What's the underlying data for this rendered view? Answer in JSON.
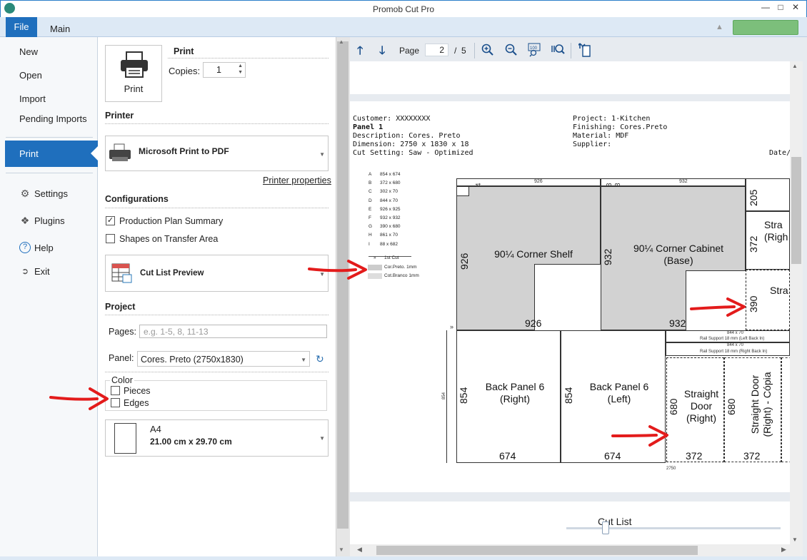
{
  "window": {
    "title": "Promob Cut Pro"
  },
  "tabs": {
    "file": "File",
    "main": "Main"
  },
  "menu": {
    "new": "New",
    "open": "Open",
    "import": "Import",
    "pending": "Pending Imports",
    "print": "Print",
    "settings": "Settings",
    "plugins": "Plugins",
    "help": "Help",
    "exit": "Exit"
  },
  "print_section": {
    "print_button": "Print",
    "title": "Print",
    "copies_label": "Copies:",
    "copies_value": "1"
  },
  "printer": {
    "title": "Printer",
    "name": "Microsoft Print to PDF",
    "properties_link": "Printer properties"
  },
  "configurations": {
    "title": "Configurations",
    "production_plan": "Production Plan Summary",
    "production_plan_checked": true,
    "shapes_transfer": "Shapes on Transfer Area",
    "shapes_transfer_checked": false,
    "report": "Cut List Preview"
  },
  "project": {
    "title": "Project",
    "pages_label": "Pages:",
    "pages_placeholder": "e.g. 1-5, 8, 11-13",
    "panel_label": "Panel:",
    "panel_value": "Cores. Preto (2750x1830)",
    "color_title": "Color",
    "pieces": "Pieces",
    "edges": "Edges",
    "paper_name": "A4",
    "paper_size": "21.00 cm x 29.70 cm"
  },
  "preview": {
    "page_label": "Page",
    "page_current": "2",
    "page_sep": "/",
    "page_total": "5",
    "header_left": [
      "Customer: XXXXXXXX",
      "Panel 1",
      "Description: Cores. Preto",
      "Dimension: 2750 x 1830 x 18",
      "Cut Setting: Saw - Optimized"
    ],
    "header_right": [
      "Project: 1-Kitchen",
      "Finishing: Cores.Preto",
      "Material: MDF",
      "Supplier:"
    ],
    "date_label": "Date/",
    "legend": [
      {
        "k": "A",
        "v": "854 x 674"
      },
      {
        "k": "B",
        "v": "372 x 680"
      },
      {
        "k": "C",
        "v": "302 x 70"
      },
      {
        "k": "D",
        "v": "844 x 70"
      },
      {
        "k": "E",
        "v": "926 x 925"
      },
      {
        "k": "F",
        "v": "932 x 932"
      },
      {
        "k": "G",
        "v": "390 x 680"
      },
      {
        "k": "H",
        "v": "861 x 70"
      },
      {
        "k": "I",
        "v": "88 x 682"
      }
    ],
    "legend_cut": "1st Cut",
    "legend_edge1": "Cor.Preto.  1mm",
    "legend_edge2": "Cot.Branco  1mm",
    "footer_label": "Cut List",
    "parts": {
      "p1_name": "90¼ Corner Shelf",
      "p1_w": "926",
      "p1_h": "926",
      "p1_top": "926",
      "p2_name": "90¼ Corner Cabinet (Base)",
      "p2_w": "932",
      "p2_h": "932",
      "p2_top": "932",
      "p3_name": "Back Panel 6 (Right)",
      "p3_w": "674",
      "p3_h": "854",
      "p4_name": "Back Panel 6 (Left)",
      "p4_w": "674",
      "p4_h": "854",
      "p5_name": "Straight Door (Right)",
      "p5_w": "372",
      "p5_h": "680",
      "p6_name": "Straight Door (Right) - Cópia",
      "p6_w": "372",
      "p6_h": "680",
      "p7_name": "Stra (Righ",
      "p7_h": "372",
      "p8_name": "Stra",
      "p8_h": "390",
      "top_right_dim": "205",
      "strip1": "Rail Support 18 mm (Left Back In)",
      "strip2": "Rail Support 18 mm (Right Back In)",
      "strip_dim1": "844 x 70",
      "strip_dim2": "844 x 70",
      "left_total": "854",
      "bottom_total": "2750",
      "corner_a": "4",
      "corner_b": "3",
      "corner_c": "8"
    }
  }
}
